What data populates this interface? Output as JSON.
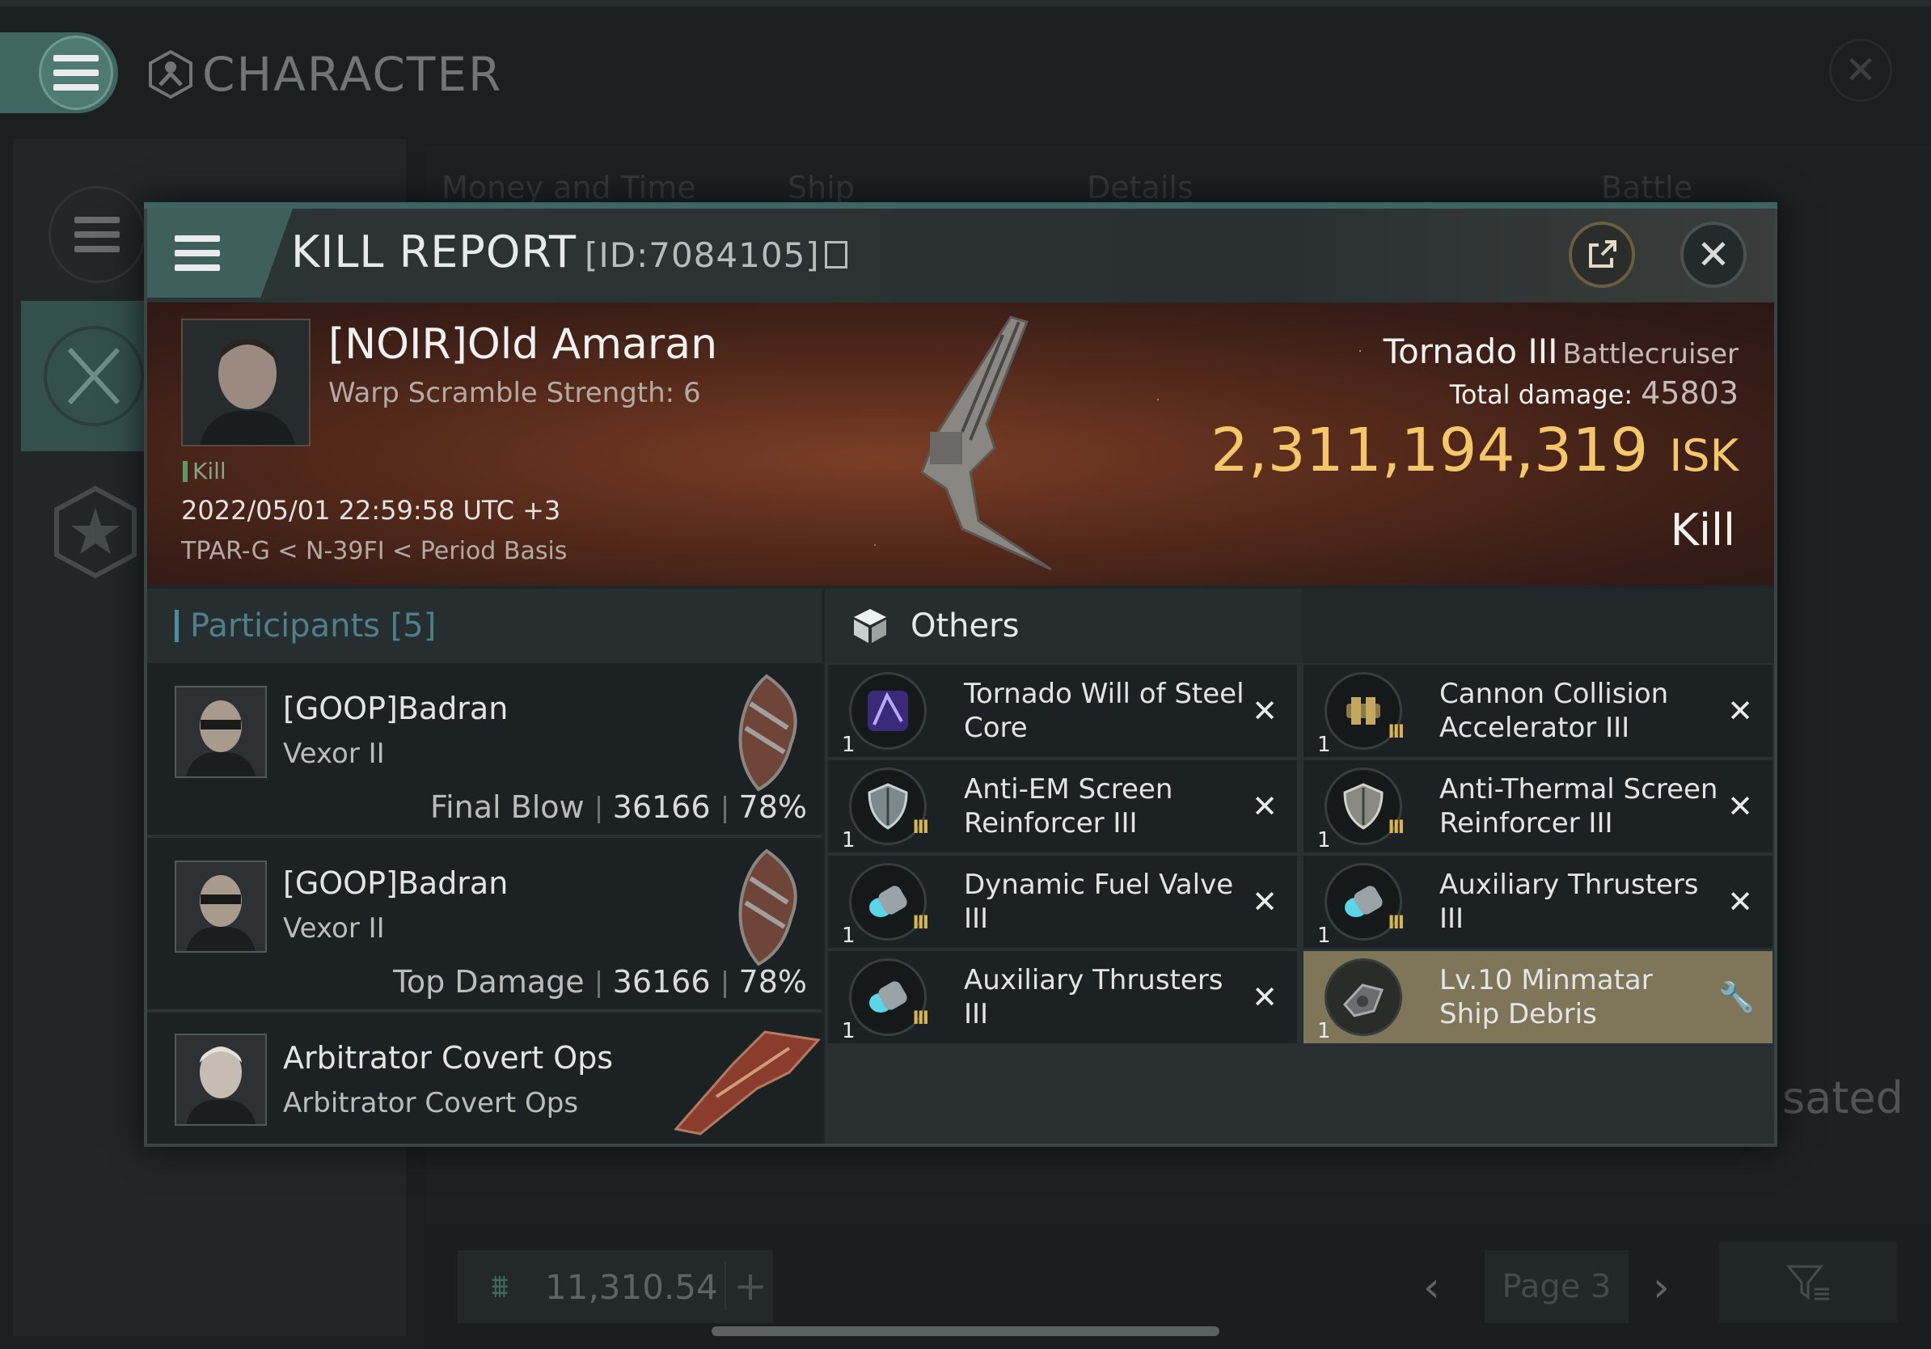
{
  "app": {
    "title": "CHARACTER",
    "close_icon": "close-icon"
  },
  "background": {
    "tabs": [
      "Money and Time",
      "Ship",
      "Details",
      "Battle Status"
    ],
    "partial_text": "sated",
    "wallet_value": "11,310.54",
    "page_label": "Page 3"
  },
  "dialog": {
    "title": "KILL REPORT",
    "report_id": "[ID:7084105]"
  },
  "victim": {
    "name": "[NOIR]Old Amaran",
    "subtitle": "Warp Scramble Strength: 6",
    "result_tag": "Kill",
    "timestamp": "2022/05/01 22:59:58 UTC +3",
    "location": "TPAR-G < N-39FI < Period Basis",
    "ship_name": "Tornado III",
    "ship_class": "Battlecruiser",
    "total_damage_label": "Total damage:",
    "total_damage": "45803",
    "isk_value": "2,311,194,319",
    "isk_unit": "ISK",
    "result": "Kill"
  },
  "participants": {
    "heading": "Participants [5]",
    "rows": [
      {
        "name": "[GOOP]Badran",
        "ship": "Vexor II",
        "stat_label": "Final Blow",
        "damage": "36166",
        "percent": "78%"
      },
      {
        "name": "[GOOP]Badran",
        "ship": "Vexor II",
        "stat_label": "Top Damage",
        "damage": "36166",
        "percent": "78%"
      },
      {
        "name": "Arbitrator Covert Ops",
        "ship": "Arbitrator Covert Ops"
      }
    ]
  },
  "others": {
    "heading": "Others",
    "items": [
      {
        "name": "Tornado Will of Steel Core",
        "qty": "1",
        "tier": "",
        "icon": "core-icon",
        "highlighted": false
      },
      {
        "name": "Cannon Collision Accelerator III",
        "qty": "1",
        "tier": "III",
        "icon": "accelerator-icon",
        "highlighted": false
      },
      {
        "name": "Anti-EM Screen Reinforcer III",
        "qty": "1",
        "tier": "III",
        "icon": "shield-icon",
        "highlighted": false
      },
      {
        "name": "Anti-Thermal Screen Reinforcer III",
        "qty": "1",
        "tier": "III",
        "icon": "shield-icon",
        "highlighted": false
      },
      {
        "name": "Dynamic Fuel Valve III",
        "qty": "1",
        "tier": "III",
        "icon": "thruster-icon",
        "highlighted": false
      },
      {
        "name": "Auxiliary Thrusters III",
        "qty": "1",
        "tier": "III",
        "icon": "thruster-icon",
        "highlighted": false
      },
      {
        "name": "Auxiliary Thrusters III",
        "qty": "1",
        "tier": "III",
        "icon": "thruster-icon",
        "highlighted": false
      },
      {
        "name": "Lv.10 Minmatar Ship Debris",
        "qty": "1",
        "tier": "",
        "icon": "debris-icon",
        "highlighted": true
      }
    ]
  },
  "colors": {
    "accent_teal": "#3e5f5b",
    "isk_gold": "#f3c76a",
    "highlight_item": "#7f7558"
  }
}
